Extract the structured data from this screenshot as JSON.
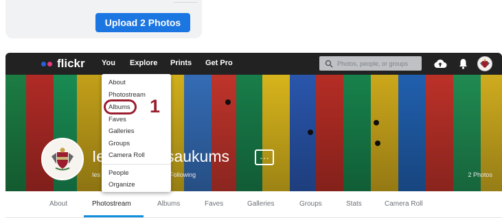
{
  "upload": {
    "button_label": "Upload 2 Photos"
  },
  "nav": {
    "logo_text": "flickr",
    "links": [
      "You",
      "Explore",
      "Prints",
      "Get Pro"
    ],
    "search_placeholder": "Photos, people, or groups",
    "icons": [
      "cloud-upload-icon",
      "bell-icon",
      "avatar-icon"
    ]
  },
  "profile": {
    "name_prefix": "Ie",
    "name_suffix": "osaukums",
    "more_label": "···",
    "stats_prefix": "Ies",
    "stats_suffix": "• 1 Following",
    "photo_count": "2 Photos"
  },
  "dropdown": {
    "items": [
      "About",
      "Photostream",
      "Albums",
      "Faves",
      "Galleries",
      "Groups",
      "Camera Roll",
      "People",
      "Organize"
    ]
  },
  "annotation": {
    "step_number": "1",
    "color": "#9a1e2e"
  },
  "tabs": {
    "items": [
      "About",
      "Photostream",
      "Albums",
      "Faves",
      "Galleries",
      "Groups",
      "Stats",
      "Camera Roll"
    ],
    "active": "Photostream"
  },
  "colors": {
    "nav_bg": "#222222",
    "accent_blue": "#1c76e2",
    "tab_underline": "#128fdc"
  }
}
